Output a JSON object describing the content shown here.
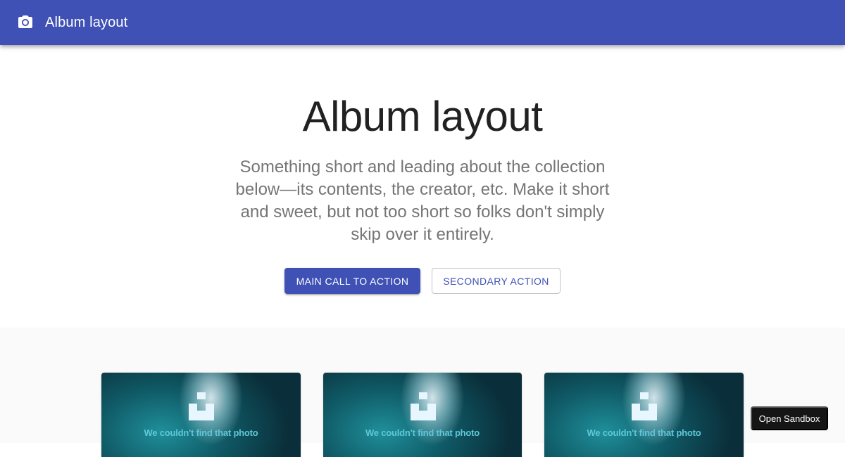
{
  "appbar": {
    "icon": "camera-icon",
    "title": "Album layout",
    "color": "#3f51b5"
  },
  "hero": {
    "title": "Album layout",
    "description": "Something short and leading about the collection below—its contents, the creator, etc. Make it short and sweet, but not too short so folks don't simply skip over it entirely.",
    "primary_action": "MAIN CALL TO ACTION",
    "secondary_action": "SECONDARY ACTION"
  },
  "cards": [
    {
      "image_message": "We couldn't find that photo",
      "icon": "unsplash-logo-icon"
    },
    {
      "image_message": "We couldn't find that photo",
      "icon": "unsplash-logo-icon"
    },
    {
      "image_message": "We couldn't find that photo",
      "icon": "unsplash-logo-icon"
    }
  ],
  "sandbox_button": "Open Sandbox"
}
